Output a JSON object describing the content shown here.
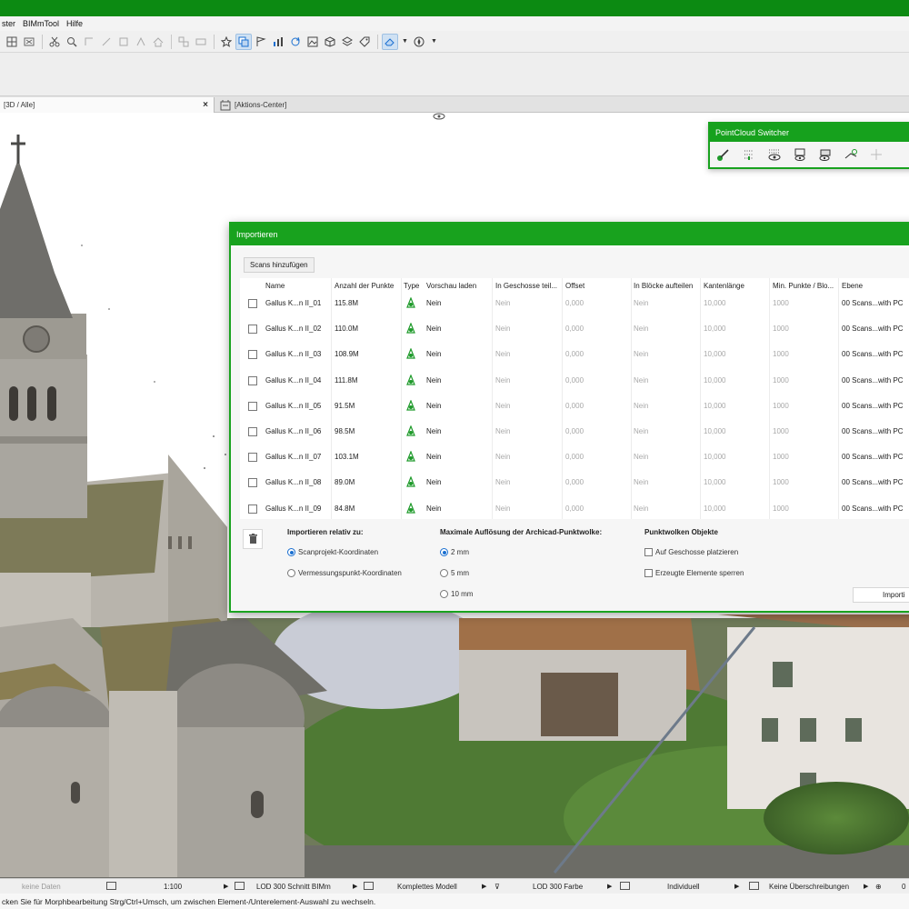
{
  "menu": {
    "items": [
      "ster",
      "BIMmTool",
      "Hilfe"
    ]
  },
  "tabs": [
    {
      "label": "[3D / Alle]"
    },
    {
      "label": "[Aktions-Center]"
    }
  ],
  "pointcloud_switcher": {
    "title": "PointCloud Switcher"
  },
  "import_dialog": {
    "title": "Importieren",
    "add_scans_label": "Scans hinzufügen",
    "columns": [
      "Name",
      "Anzahl der Punkte",
      "Type",
      "Vorschau laden",
      "In Geschosse teil...",
      "Offset",
      "In Blöcke aufteilen",
      "Kantenlänge",
      "Min. Punkte / Blo...",
      "Ebene"
    ],
    "rows": [
      {
        "name": "Gallus K...n II_01",
        "points": "115.8M",
        "preview": "Nein",
        "floors": "Nein",
        "offset": "0,000",
        "blocks": "Nein",
        "edge": "10,000",
        "minpts": "1000",
        "layer": "00 Scans...with PC"
      },
      {
        "name": "Gallus K...n II_02",
        "points": "110.0M",
        "preview": "Nein",
        "floors": "Nein",
        "offset": "0,000",
        "blocks": "Nein",
        "edge": "10,000",
        "minpts": "1000",
        "layer": "00 Scans...with PC"
      },
      {
        "name": "Gallus K...n II_03",
        "points": "108.9M",
        "preview": "Nein",
        "floors": "Nein",
        "offset": "0,000",
        "blocks": "Nein",
        "edge": "10,000",
        "minpts": "1000",
        "layer": "00 Scans...with PC"
      },
      {
        "name": "Gallus K...n II_04",
        "points": "111.8M",
        "preview": "Nein",
        "floors": "Nein",
        "offset": "0,000",
        "blocks": "Nein",
        "edge": "10,000",
        "minpts": "1000",
        "layer": "00 Scans...with PC"
      },
      {
        "name": "Gallus K...n II_05",
        "points": "91.5M",
        "preview": "Nein",
        "floors": "Nein",
        "offset": "0,000",
        "blocks": "Nein",
        "edge": "10,000",
        "minpts": "1000",
        "layer": "00 Scans...with PC"
      },
      {
        "name": "Gallus K...n II_06",
        "points": "98.5M",
        "preview": "Nein",
        "floors": "Nein",
        "offset": "0,000",
        "blocks": "Nein",
        "edge": "10,000",
        "minpts": "1000",
        "layer": "00 Scans...with PC"
      },
      {
        "name": "Gallus K...n II_07",
        "points": "103.1M",
        "preview": "Nein",
        "floors": "Nein",
        "offset": "0,000",
        "blocks": "Nein",
        "edge": "10,000",
        "minpts": "1000",
        "layer": "00 Scans...with PC"
      },
      {
        "name": "Gallus K...n II_08",
        "points": "89.0M",
        "preview": "Nein",
        "floors": "Nein",
        "offset": "0,000",
        "blocks": "Nein",
        "edge": "10,000",
        "minpts": "1000",
        "layer": "00 Scans...with PC"
      },
      {
        "name": "Gallus K...n II_09",
        "points": "84.8M",
        "preview": "Nein",
        "floors": "Nein",
        "offset": "0,000",
        "blocks": "Nein",
        "edge": "10,000",
        "minpts": "1000",
        "layer": "00 Scans...with PC"
      }
    ],
    "relative_title": "Importieren relativ zu:",
    "relative_options": [
      "Scanprojekt-Koordinaten",
      "Vermessungspunkt-Koordinaten"
    ],
    "relative_selected": "Scanprojekt-Koordinaten",
    "resolution_title": "Maximale Auflösung der Archicad-Punktwolke:",
    "resolution_options": [
      "2 mm",
      "5 mm",
      "10 mm"
    ],
    "resolution_selected": "2 mm",
    "objects_title": "Punktwolken Objekte",
    "objects_options": [
      "Auf Geschosse platzieren",
      "Erzeugte Elemente sperren"
    ],
    "import_label": "Importi"
  },
  "statusbar": {
    "no_data": "keine Daten",
    "scale": "1:100",
    "lod": "LOD 300 Schnitt BIMm",
    "model": "Komplettes Modell",
    "lod_color": "LOD 300 Farbe",
    "individual": "Individuell",
    "overrides": "Keine Überschreibungen",
    "last": "0"
  },
  "hint": "cken Sie für Morphbearbeitung Strg/Ctrl+Umsch, um zwischen Element-/Unterelement-Auswahl zu wechseln.",
  "colors": {
    "accent_green": "#18a21e",
    "title_green": "#0c8a12",
    "selection_blue": "#1a6fd0"
  }
}
